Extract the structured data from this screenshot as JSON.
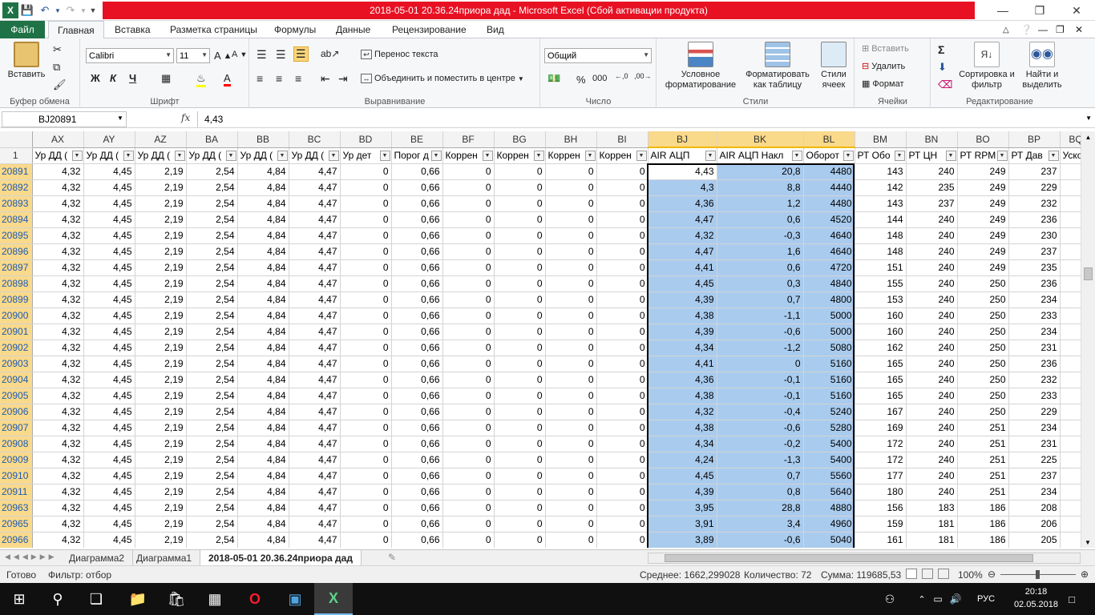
{
  "titlebar": {
    "title": "2018-05-01 20.36.24приора дад  -  Microsoft Excel (Сбой активации продукта)"
  },
  "menu": {
    "file": "Файл",
    "tabs": [
      "Главная",
      "Вставка",
      "Разметка страницы",
      "Формулы",
      "Данные",
      "Рецензирование",
      "Вид"
    ]
  },
  "ribbon": {
    "clipboard": {
      "paste": "Вставить",
      "label": "Буфер обмена"
    },
    "font": {
      "name": "Calibri",
      "size": "11",
      "label": "Шрифт",
      "bold": "Ж",
      "italic": "К",
      "underline": "Ч"
    },
    "alignment": {
      "wrap": "Перенос текста",
      "merge": "Объединить и поместить в центре",
      "label": "Выравнивание"
    },
    "number": {
      "format": "Общий",
      "percent": "%",
      "thousands": "000",
      "label": "Число"
    },
    "styles": {
      "conditional": "Условное форматирование",
      "as_table": "Форматировать как таблицу",
      "cell_styles": "Стили ячеек",
      "label": "Стили"
    },
    "cells": {
      "insert": "Вставить",
      "delete": "Удалить",
      "format": "Формат",
      "label": "Ячейки"
    },
    "editing": {
      "sort": "Сортировка и фильтр",
      "find": "Найти и выделить",
      "label": "Редактирование"
    }
  },
  "formula_bar": {
    "name_box": "BJ20891",
    "fx": "fx",
    "value": "4,43"
  },
  "grid": {
    "columns": [
      "AX",
      "AY",
      "AZ",
      "BA",
      "BB",
      "BC",
      "BD",
      "BE",
      "BF",
      "BG",
      "BH",
      "BI",
      "BJ",
      "BK",
      "BL",
      "BM",
      "BN",
      "BO",
      "BP",
      "BQ"
    ],
    "header_row_number": "1",
    "header_cells": [
      "Ур ДД (",
      "Ур ДД (",
      "Ур ДД (",
      "Ур ДД (",
      "Ур ДД (",
      "Ур ДД (",
      "Ур дет",
      "Порог д",
      "Коррен",
      "Коррен",
      "Коррен",
      "Коррен",
      "AIR АЦП",
      "AIR АЦП Накл",
      "Оборот",
      "РТ Обо",
      "РТ ЦН",
      "РТ RPM",
      "РТ Дав",
      "Ускор"
    ],
    "rows": [
      {
        "n": "20891",
        "v": [
          "4,32",
          "4,45",
          "2,19",
          "2,54",
          "4,84",
          "4,47",
          "0",
          "0,66",
          "0",
          "0",
          "0",
          "0",
          "4,43",
          "20,8",
          "4480",
          "143",
          "240",
          "249",
          "237"
        ]
      },
      {
        "n": "20892",
        "v": [
          "4,32",
          "4,45",
          "2,19",
          "2,54",
          "4,84",
          "4,47",
          "0",
          "0,66",
          "0",
          "0",
          "0",
          "0",
          "4,3",
          "8,8",
          "4440",
          "142",
          "235",
          "249",
          "229"
        ]
      },
      {
        "n": "20893",
        "v": [
          "4,32",
          "4,45",
          "2,19",
          "2,54",
          "4,84",
          "4,47",
          "0",
          "0,66",
          "0",
          "0",
          "0",
          "0",
          "4,36",
          "1,2",
          "4480",
          "143",
          "237",
          "249",
          "232"
        ]
      },
      {
        "n": "20894",
        "v": [
          "4,32",
          "4,45",
          "2,19",
          "2,54",
          "4,84",
          "4,47",
          "0",
          "0,66",
          "0",
          "0",
          "0",
          "0",
          "4,47",
          "0,6",
          "4520",
          "144",
          "240",
          "249",
          "236"
        ]
      },
      {
        "n": "20895",
        "v": [
          "4,32",
          "4,45",
          "2,19",
          "2,54",
          "4,84",
          "4,47",
          "0",
          "0,66",
          "0",
          "0",
          "0",
          "0",
          "4,32",
          "-0,3",
          "4640",
          "148",
          "240",
          "249",
          "230"
        ]
      },
      {
        "n": "20896",
        "v": [
          "4,32",
          "4,45",
          "2,19",
          "2,54",
          "4,84",
          "4,47",
          "0",
          "0,66",
          "0",
          "0",
          "0",
          "0",
          "4,47",
          "1,6",
          "4640",
          "148",
          "240",
          "249",
          "237"
        ]
      },
      {
        "n": "20897",
        "v": [
          "4,32",
          "4,45",
          "2,19",
          "2,54",
          "4,84",
          "4,47",
          "0",
          "0,66",
          "0",
          "0",
          "0",
          "0",
          "4,41",
          "0,6",
          "4720",
          "151",
          "240",
          "249",
          "235"
        ]
      },
      {
        "n": "20898",
        "v": [
          "4,32",
          "4,45",
          "2,19",
          "2,54",
          "4,84",
          "4,47",
          "0",
          "0,66",
          "0",
          "0",
          "0",
          "0",
          "4,45",
          "0,3",
          "4840",
          "155",
          "240",
          "250",
          "236"
        ]
      },
      {
        "n": "20899",
        "v": [
          "4,32",
          "4,45",
          "2,19",
          "2,54",
          "4,84",
          "4,47",
          "0",
          "0,66",
          "0",
          "0",
          "0",
          "0",
          "4,39",
          "0,7",
          "4800",
          "153",
          "240",
          "250",
          "234"
        ]
      },
      {
        "n": "20900",
        "v": [
          "4,32",
          "4,45",
          "2,19",
          "2,54",
          "4,84",
          "4,47",
          "0",
          "0,66",
          "0",
          "0",
          "0",
          "0",
          "4,38",
          "-1,1",
          "5000",
          "160",
          "240",
          "250",
          "233"
        ]
      },
      {
        "n": "20901",
        "v": [
          "4,32",
          "4,45",
          "2,19",
          "2,54",
          "4,84",
          "4,47",
          "0",
          "0,66",
          "0",
          "0",
          "0",
          "0",
          "4,39",
          "-0,6",
          "5000",
          "160",
          "240",
          "250",
          "234"
        ]
      },
      {
        "n": "20902",
        "v": [
          "4,32",
          "4,45",
          "2,19",
          "2,54",
          "4,84",
          "4,47",
          "0",
          "0,66",
          "0",
          "0",
          "0",
          "0",
          "4,34",
          "-1,2",
          "5080",
          "162",
          "240",
          "250",
          "231"
        ]
      },
      {
        "n": "20903",
        "v": [
          "4,32",
          "4,45",
          "2,19",
          "2,54",
          "4,84",
          "4,47",
          "0",
          "0,66",
          "0",
          "0",
          "0",
          "0",
          "4,41",
          "0",
          "5160",
          "165",
          "240",
          "250",
          "236"
        ]
      },
      {
        "n": "20904",
        "v": [
          "4,32",
          "4,45",
          "2,19",
          "2,54",
          "4,84",
          "4,47",
          "0",
          "0,66",
          "0",
          "0",
          "0",
          "0",
          "4,36",
          "-0,1",
          "5160",
          "165",
          "240",
          "250",
          "232"
        ]
      },
      {
        "n": "20905",
        "v": [
          "4,32",
          "4,45",
          "2,19",
          "2,54",
          "4,84",
          "4,47",
          "0",
          "0,66",
          "0",
          "0",
          "0",
          "0",
          "4,38",
          "-0,1",
          "5160",
          "165",
          "240",
          "250",
          "233"
        ]
      },
      {
        "n": "20906",
        "v": [
          "4,32",
          "4,45",
          "2,19",
          "2,54",
          "4,84",
          "4,47",
          "0",
          "0,66",
          "0",
          "0",
          "0",
          "0",
          "4,32",
          "-0,4",
          "5240",
          "167",
          "240",
          "250",
          "229"
        ]
      },
      {
        "n": "20907",
        "v": [
          "4,32",
          "4,45",
          "2,19",
          "2,54",
          "4,84",
          "4,47",
          "0",
          "0,66",
          "0",
          "0",
          "0",
          "0",
          "4,38",
          "-0,6",
          "5280",
          "169",
          "240",
          "251",
          "234"
        ]
      },
      {
        "n": "20908",
        "v": [
          "4,32",
          "4,45",
          "2,19",
          "2,54",
          "4,84",
          "4,47",
          "0",
          "0,66",
          "0",
          "0",
          "0",
          "0",
          "4,34",
          "-0,2",
          "5400",
          "172",
          "240",
          "251",
          "231"
        ]
      },
      {
        "n": "20909",
        "v": [
          "4,32",
          "4,45",
          "2,19",
          "2,54",
          "4,84",
          "4,47",
          "0",
          "0,66",
          "0",
          "0",
          "0",
          "0",
          "4,24",
          "-1,3",
          "5400",
          "172",
          "240",
          "251",
          "225"
        ]
      },
      {
        "n": "20910",
        "v": [
          "4,32",
          "4,45",
          "2,19",
          "2,54",
          "4,84",
          "4,47",
          "0",
          "0,66",
          "0",
          "0",
          "0",
          "0",
          "4,45",
          "0,7",
          "5560",
          "177",
          "240",
          "251",
          "237"
        ]
      },
      {
        "n": "20911",
        "v": [
          "4,32",
          "4,45",
          "2,19",
          "2,54",
          "4,84",
          "4,47",
          "0",
          "0,66",
          "0",
          "0",
          "0",
          "0",
          "4,39",
          "0,8",
          "5640",
          "180",
          "240",
          "251",
          "234"
        ]
      },
      {
        "n": "20963",
        "v": [
          "4,32",
          "4,45",
          "2,19",
          "2,54",
          "4,84",
          "4,47",
          "0",
          "0,66",
          "0",
          "0",
          "0",
          "0",
          "3,95",
          "28,8",
          "4880",
          "156",
          "183",
          "186",
          "208"
        ]
      },
      {
        "n": "20965",
        "v": [
          "4,32",
          "4,45",
          "2,19",
          "2,54",
          "4,84",
          "4,47",
          "0",
          "0,66",
          "0",
          "0",
          "0",
          "0",
          "3,91",
          "3,4",
          "4960",
          "159",
          "181",
          "186",
          "206"
        ]
      },
      {
        "n": "20966",
        "v": [
          "4,32",
          "4,45",
          "2,19",
          "2,54",
          "4,84",
          "4,47",
          "0",
          "0,66",
          "0",
          "0",
          "0",
          "0",
          "3,89",
          "-0,6",
          "5040",
          "161",
          "181",
          "186",
          "205"
        ]
      }
    ]
  },
  "sheets": {
    "tabs": [
      "Диаграмма2",
      "Диаграмма1",
      "2018-05-01 20.36.24приора дад"
    ],
    "active_index": 2
  },
  "status": {
    "ready": "Готово",
    "filter": "Фильтр: отбор",
    "average": "Среднее: 1662,299028",
    "count": "Количество: 72",
    "sum": "Сумма: 119685,53",
    "zoom": "100%"
  },
  "taskbar": {
    "lang": "РУС",
    "time": "20:18",
    "date": "02.05.2018"
  },
  "colors": {
    "excel_green": "#1f7245",
    "title_red": "#e81123",
    "selection": "#a9cbee",
    "header_selected": "#f9d98a",
    "row_number_blue": "#1e5ab4"
  }
}
